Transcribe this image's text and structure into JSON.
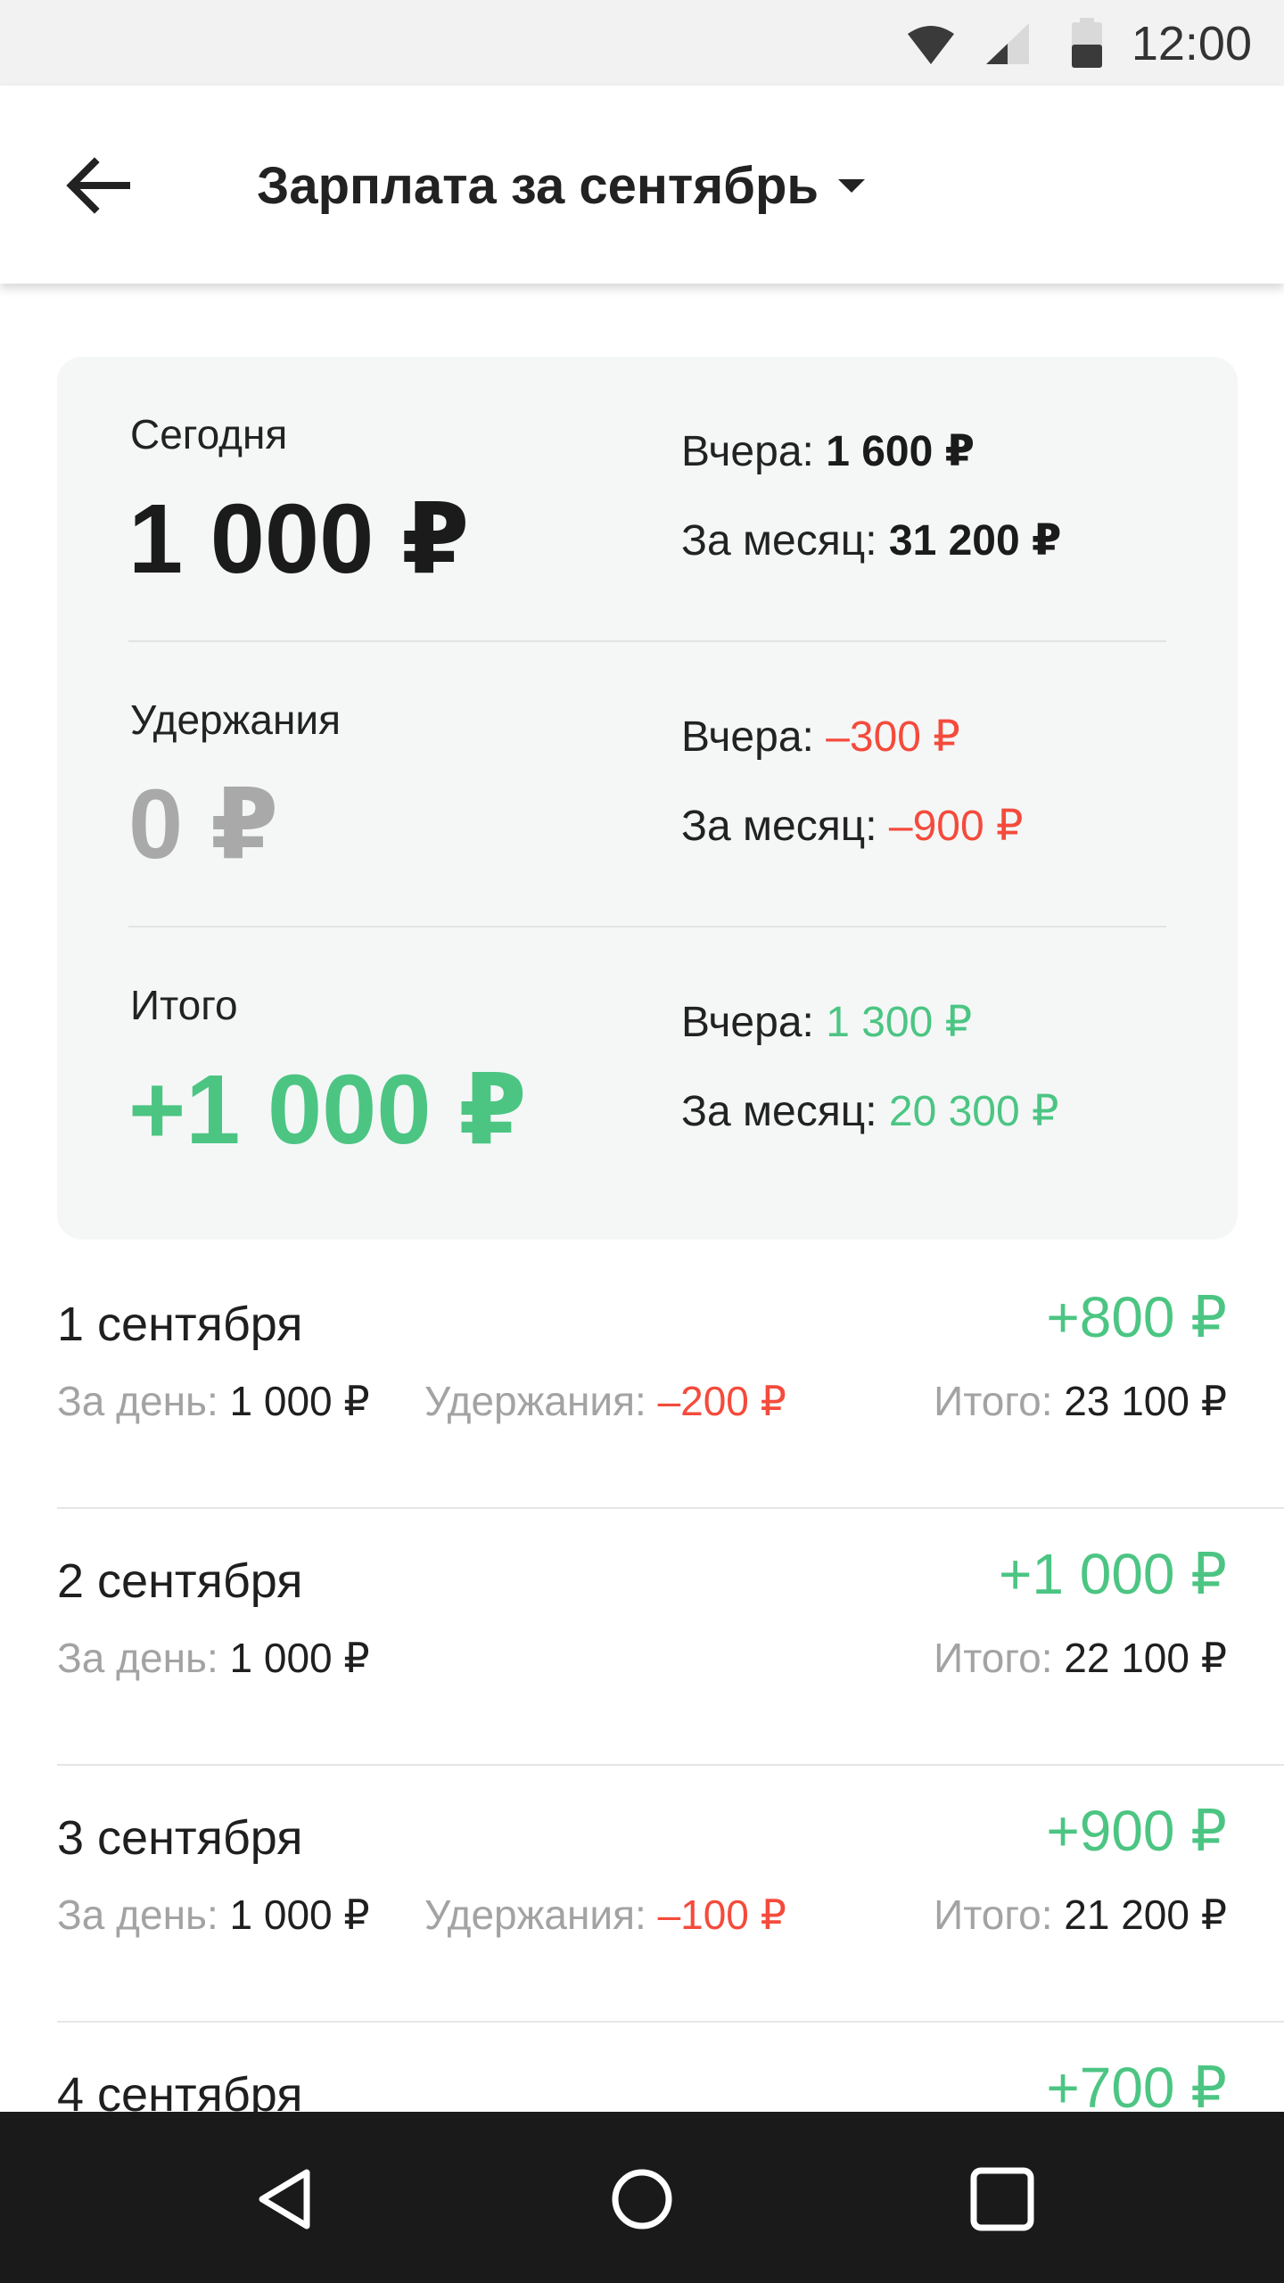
{
  "status_bar": {
    "time": "12:00"
  },
  "header": {
    "title": "Зарплата за сентябрь"
  },
  "summary": {
    "today": {
      "label": "Сегодня",
      "amount": "1 000 ₽",
      "yesterday_label": "Вчера: ",
      "yesterday_value": "1 600 ₽",
      "month_label": "За месяц: ",
      "month_value": "31 200 ₽"
    },
    "deductions": {
      "label": "Удержания",
      "amount": "0 ₽",
      "yesterday_label": "Вчера: ",
      "yesterday_value": "–300 ₽",
      "month_label": "За месяц: ",
      "month_value": "–900 ₽"
    },
    "total": {
      "label": "Итого",
      "amount": "+1 000 ₽",
      "yesterday_label": "Вчера: ",
      "yesterday_value": "1 300 ₽",
      "month_label": "За месяц: ",
      "month_value": "20 300 ₽"
    }
  },
  "days": [
    {
      "date": "1 сентября",
      "total": "+800 ₽",
      "day_label": "За день: ",
      "day_value": "1 000 ₽",
      "ded_label": "Удержания: ",
      "ded_value": "–200 ₽",
      "sum_label": "Итого: ",
      "sum_value": "23 100 ₽"
    },
    {
      "date": "2 сентября",
      "total": "+1 000 ₽",
      "day_label": "За день: ",
      "day_value": "1 000 ₽",
      "sum_label": "Итого: ",
      "sum_value": "22 100 ₽"
    },
    {
      "date": "3 сентября",
      "total": "+900 ₽",
      "day_label": "За день: ",
      "day_value": "1 000 ₽",
      "ded_label": "Удержания: ",
      "ded_value": "–100 ₽",
      "sum_label": "Итого: ",
      "sum_value": "21 200 ₽"
    },
    {
      "date": "4 сентября",
      "total": "+700 ₽"
    }
  ],
  "colors": {
    "green": "#4cc583",
    "red": "#f44b3c",
    "gray": "#a9a9a9",
    "card": "#f5f7f7"
  },
  "icons": [
    "wifi-icon",
    "signal-icon",
    "battery-icon",
    "back-arrow-icon",
    "dropdown-caret-icon",
    "nav-back-icon",
    "nav-home-icon",
    "nav-recents-icon"
  ]
}
